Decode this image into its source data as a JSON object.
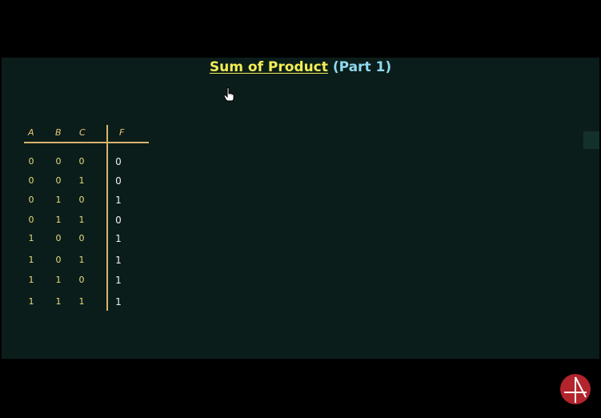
{
  "title": {
    "main": "Sum of Product",
    "sub": "(Part 1)"
  },
  "truth_table": {
    "headers": [
      "A",
      "B",
      "C",
      "F"
    ],
    "rows": [
      [
        "0",
        "0",
        "0",
        "0"
      ],
      [
        "0",
        "0",
        "1",
        "0"
      ],
      [
        "0",
        "1",
        "0",
        "1"
      ],
      [
        "0",
        "1",
        "1",
        "0"
      ],
      [
        "1",
        "0",
        "0",
        "1"
      ],
      [
        "1",
        "0",
        "1",
        "1"
      ],
      [
        "1",
        "1",
        "0",
        "1"
      ],
      [
        "1",
        "1",
        "1",
        "1"
      ]
    ]
  },
  "colors": {
    "board": "#0b1d1a",
    "title": "#f2ee55",
    "subtitle": "#8fd8ef",
    "table_text": "#e6dd7d",
    "table_lines": "#d8b46e",
    "output_text": "#f0f0f0",
    "logo": "#b3242c"
  },
  "icons": {
    "cursor": "hand-pointer-icon",
    "logo": "channel-logo-icon"
  }
}
